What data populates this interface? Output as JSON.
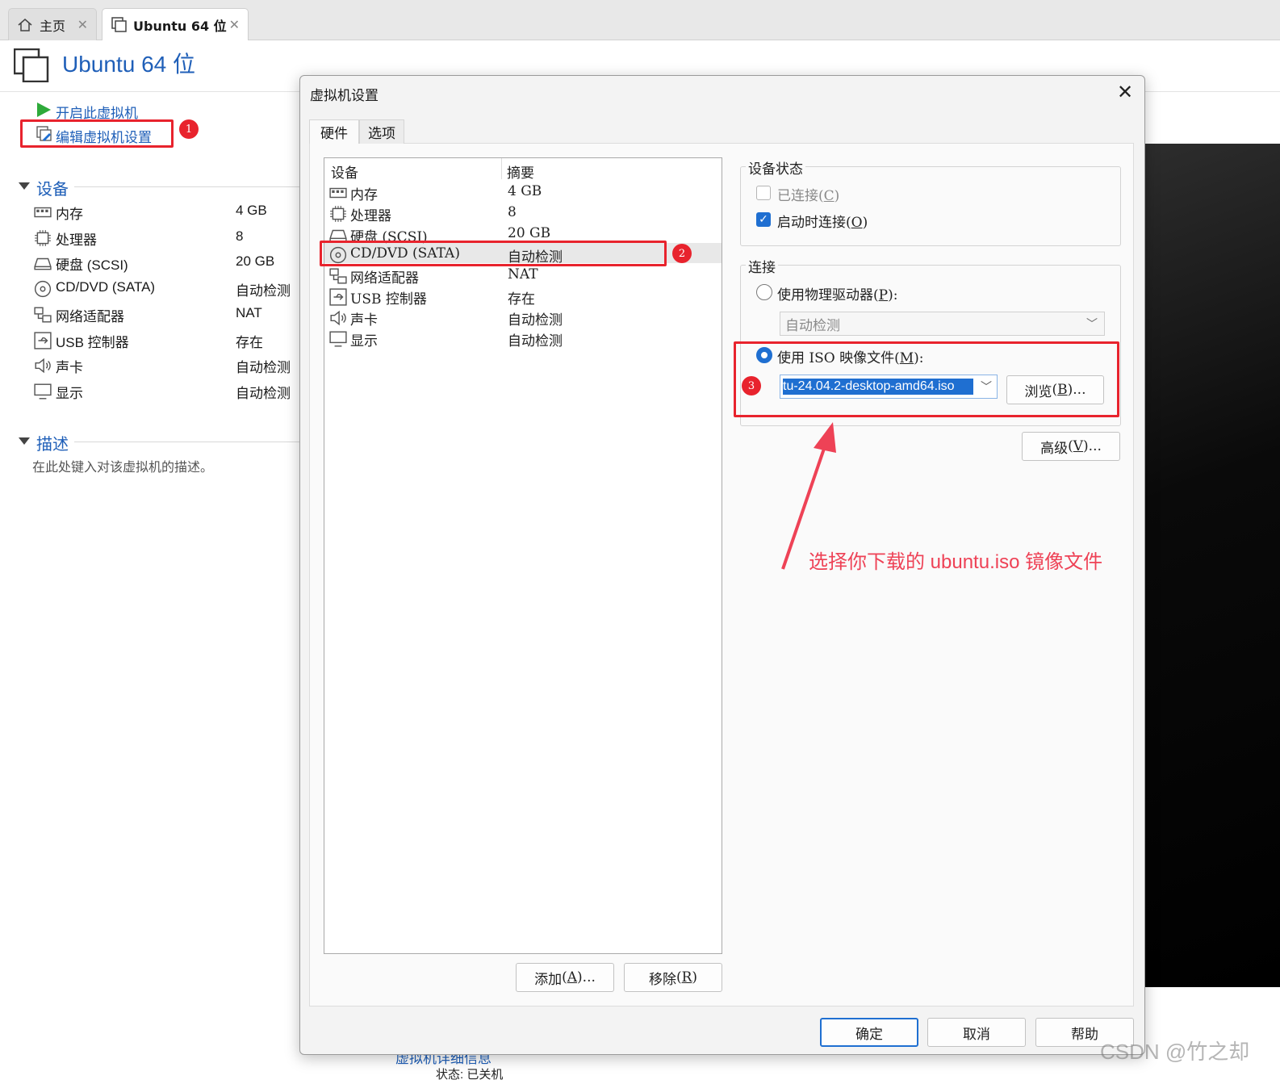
{
  "tabs": [
    {
      "label": "主页",
      "icon": "home-icon"
    },
    {
      "label": "Ubuntu 64 位",
      "icon": "vm-icon"
    }
  ],
  "vm": {
    "title": "Ubuntu 64 位",
    "actions": {
      "start": "开启此虚拟机",
      "edit": "编辑虚拟机设置"
    },
    "devices_section": "设备",
    "devices": [
      {
        "name": "内存",
        "value": "4 GB",
        "icon": "memory-icon"
      },
      {
        "name": "处理器",
        "value": "8",
        "icon": "processor-icon"
      },
      {
        "name": "硬盘 (SCSI)",
        "value": "20 GB",
        "icon": "harddisk-icon"
      },
      {
        "name": "CD/DVD (SATA)",
        "value": "自动检测",
        "icon": "cdrom-icon"
      },
      {
        "name": "网络适配器",
        "value": "NAT",
        "icon": "network-icon"
      },
      {
        "name": "USB 控制器",
        "value": "存在",
        "icon": "usb-icon"
      },
      {
        "name": "声卡",
        "value": "自动检测",
        "icon": "sound-icon"
      },
      {
        "name": "显示",
        "value": "自动检测",
        "icon": "display-icon"
      }
    ],
    "description_section": "描述",
    "description_placeholder": "在此处键入对该虚拟机的描述。",
    "details_peek": "虚拟机详细信息",
    "details_state": "状态: 已关机"
  },
  "dialog": {
    "title": "虚拟机设置",
    "tabs": [
      "硬件",
      "选项"
    ],
    "list_headers": {
      "device": "设备",
      "summary": "摘要"
    },
    "list": [
      {
        "name": "内存",
        "value": "4 GB"
      },
      {
        "name": "处理器",
        "value": "8"
      },
      {
        "name": "硬盘 (SCSI)",
        "value": "20 GB"
      },
      {
        "name": "CD/DVD (SATA)",
        "value": "自动检测"
      },
      {
        "name": "网络适配器",
        "value": "NAT"
      },
      {
        "name": "USB 控制器",
        "value": "存在"
      },
      {
        "name": "声卡",
        "value": "自动检测"
      },
      {
        "name": "显示",
        "value": "自动检测"
      }
    ],
    "selected_index": 3,
    "add_button": {
      "label": "添加",
      "key": "A",
      "suffix": "..."
    },
    "remove_button": {
      "label": "移除",
      "key": "R"
    },
    "device_status": {
      "label": "设备状态",
      "connected": {
        "label": "已连接",
        "key": "C",
        "checked": false
      },
      "connect_at_power_on": {
        "label": "启动时连接",
        "key": "O",
        "checked": true
      }
    },
    "connection": {
      "label": "连接",
      "physical": {
        "label": "使用物理驱动器",
        "key": "P",
        "selected": false
      },
      "physical_value": "自动检测",
      "iso": {
        "label": "使用 ISO 映像文件",
        "key": "M",
        "selected": true
      },
      "iso_value": "tu-24.04.2-desktop-amd64.iso",
      "browse_button": {
        "label": "浏览",
        "key": "B",
        "suffix": "..."
      }
    },
    "advanced_button": {
      "label": "高级",
      "key": "V",
      "suffix": "..."
    },
    "ok_button": "确定",
    "cancel_button": "取消",
    "help_button": "帮助"
  },
  "annotations": {
    "step1": "1",
    "step2": "2",
    "step3": "3",
    "note": "选择你下载的 ubuntu.iso 镜像文件",
    "color": "#e8232d"
  },
  "watermark": "CSDN @竹之却",
  "colors": {
    "accent": "#1f6fd1",
    "link": "#1f5fb8"
  }
}
